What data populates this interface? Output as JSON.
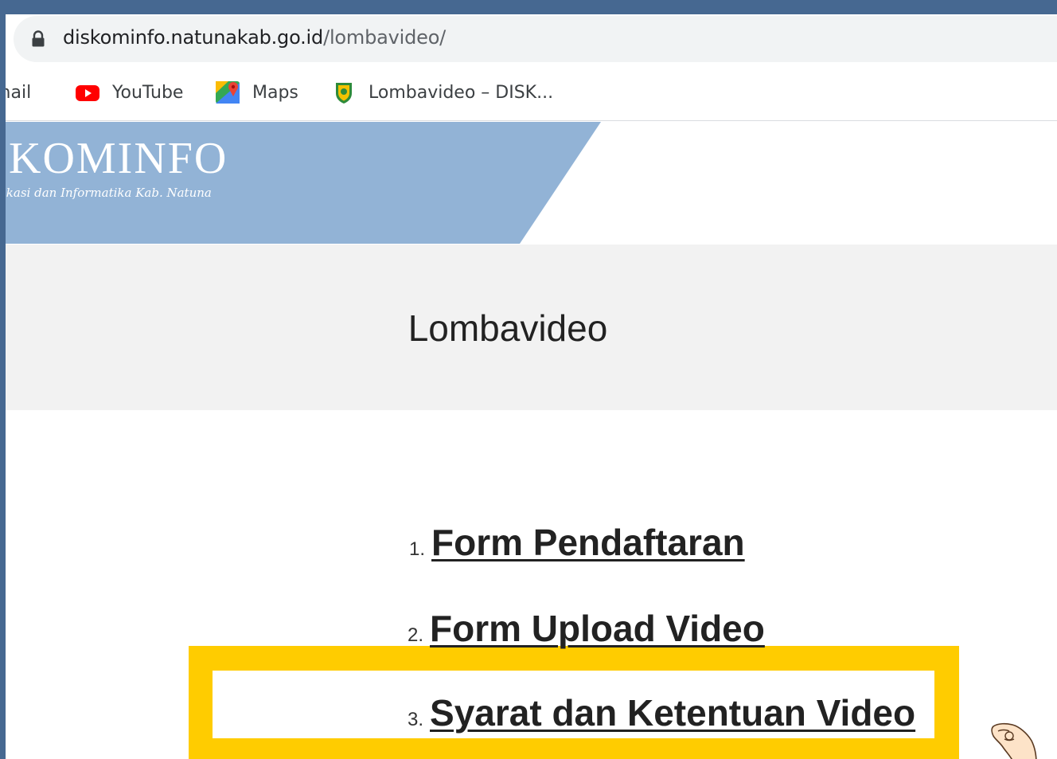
{
  "browser": {
    "url_host": "diskominfo.natunakab.go.id",
    "url_path": "/lombavideo/",
    "bookmarks": [
      {
        "label": "Gmail",
        "icon": "gmail-icon"
      },
      {
        "label": "YouTube",
        "icon": "youtube-icon"
      },
      {
        "label": "Maps",
        "icon": "maps-icon"
      },
      {
        "label": "Lombavideo – DISK...",
        "icon": "site-favicon"
      }
    ]
  },
  "site": {
    "logo_title": "KOMINFO",
    "logo_subtitle": "ikasi dan Informatika Kab. Natuna",
    "banner_color": "#92b3d6"
  },
  "page": {
    "title": "Lombavideo",
    "links": [
      {
        "number": "1.",
        "label": "Form Pendaftaran"
      },
      {
        "number": "2.",
        "label": "Form Upload Video"
      },
      {
        "number": "3.",
        "label": "Syarat dan Ketentuan Video"
      }
    ]
  },
  "annotation": {
    "highlight_color": "#ffcc00",
    "pointer": "pointing-hand-icon"
  }
}
